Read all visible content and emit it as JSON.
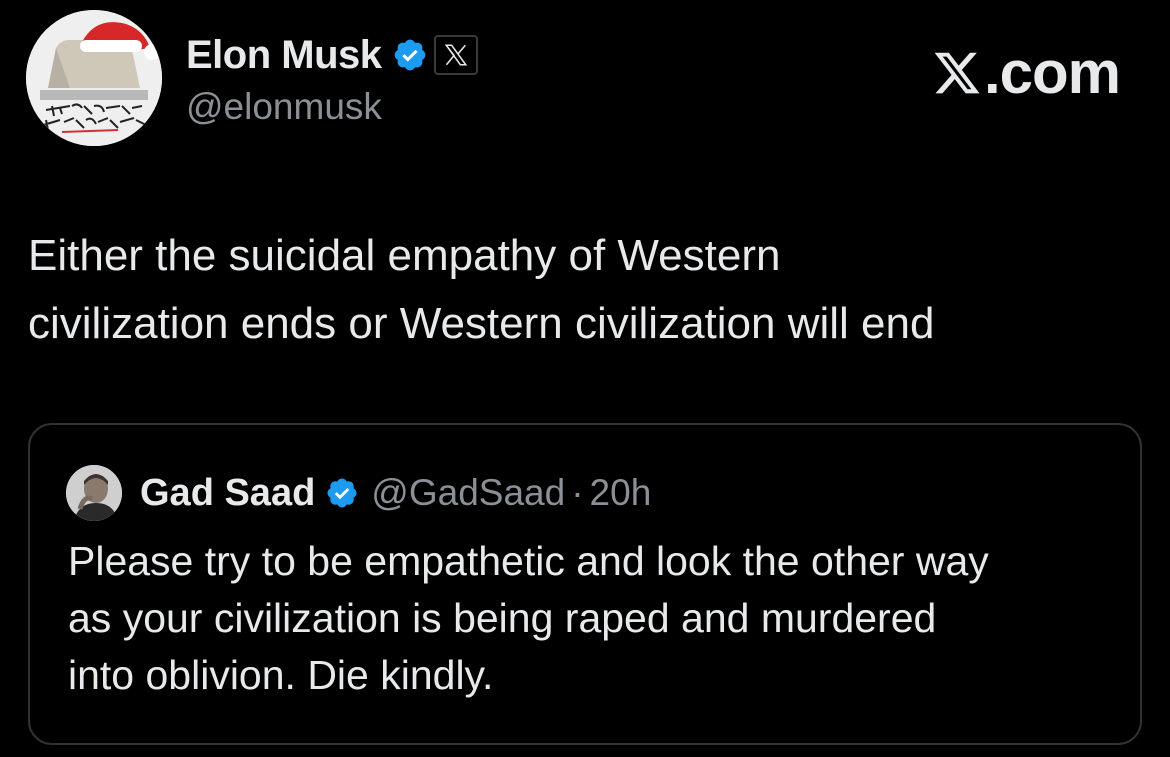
{
  "author": {
    "display_name": "Elon Musk",
    "handle": "@elonmusk",
    "avatar_caption": "THE FUTURE IS AWESOME",
    "avatar_icon": "santa-hat-avatar"
  },
  "brand": {
    "label": ".com",
    "icon": "x-logo-icon"
  },
  "tweet": {
    "line1": "Either the suicidal empathy of Western",
    "line2": "civilization ends or Western civilization will end"
  },
  "quoted": {
    "display_name": "Gad Saad",
    "handle": "@GadSaad",
    "separator": "·",
    "time": "20h",
    "line1": "Please try to be empathetic and look the other way",
    "line2": "as your civilization is being raped and murdered",
    "line3": "into oblivion. Die kindly."
  },
  "colors": {
    "background": "#000000",
    "text": "#e7e9ea",
    "muted": "#8b9096",
    "verified": "#1d9bf0",
    "border": "#2f3336"
  }
}
